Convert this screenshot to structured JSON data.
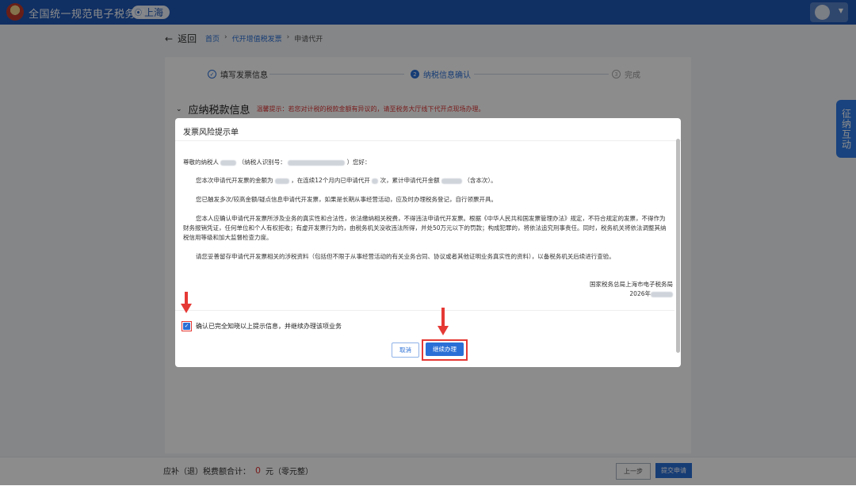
{
  "app": {
    "title": "全国统一规范电子税务局",
    "region": "上海"
  },
  "nav": {
    "back_label": "返回",
    "breadcrumb": [
      "首页",
      "代开增值税发票",
      "申请代开"
    ]
  },
  "steps": [
    {
      "label": "填写发票信息",
      "status": "done"
    },
    {
      "label": "纳税信息确认",
      "status": "active",
      "index": "2"
    },
    {
      "label": "完成",
      "status": "todo",
      "index": "3"
    }
  ],
  "section": {
    "title": "应纳税款信息",
    "tip": "温馨提示：若您对计税的税款金额有异议的，请至税务大厅线下代开点现场办理。"
  },
  "side_tab": {
    "label": "征纳互动"
  },
  "bottom": {
    "total_label": "应补（退）税费额合计：",
    "total_amount": "0",
    "total_unit": "元（零元整）",
    "prev_label": "上一步",
    "submit_label": "提交申请"
  },
  "modal": {
    "title": "发票风险提示单",
    "greeting_prefix": "尊敬的纳税人",
    "greeting_mid": "（纳税人识别号：",
    "greeting_suffix": "）您好：",
    "p1_prefix": "您本次申请代开发票的金额为",
    "p1_mid": "，在连续12个月内已申请代开",
    "p1_mid2": "次，累计申请代开金额",
    "p1_suffix": "（含本次）。",
    "p2": "您已触发多次/较高金额/疑点信息申请代开发票，如果是长期从事经营活动，应及时办理税务登记，自行领票开具。",
    "p3": "您本人应确认申请代开发票所涉及业务的真实性和合法性，依法缴纳相关税费，不得违法申请代开发票。根据《中华人民共和国发票管理办法》规定，不符合规定的发票，不得作为财务报销凭证，任何单位和个人有权拒收；有虚开发票行为的，由税务机关没收违法所得，并处50万元以下的罚款；构成犯罪的，将依法追究刑事责任。同时，税务机关将依法调整其纳税信用等级和加大监督检查力度。",
    "p4": "请您妥善留存申请代开发票相关的涉税资料（包括但不限于从事经营活动的有关业务合同、协议或者其他证明业务真实性的资料），以备税务机关后续进行查验。",
    "signer": "国家税务总局上海市电子税务局",
    "date_prefix": "2026年",
    "confirm_label": "确认已完全知晓以上提示信息，并继续办理该项业务",
    "confirm_checked": true,
    "cancel_label": "取消",
    "continue_label": "继续办理"
  },
  "colors": {
    "primary": "#2a6fd6",
    "header": "#1e57b5",
    "alert": "#e53935"
  }
}
